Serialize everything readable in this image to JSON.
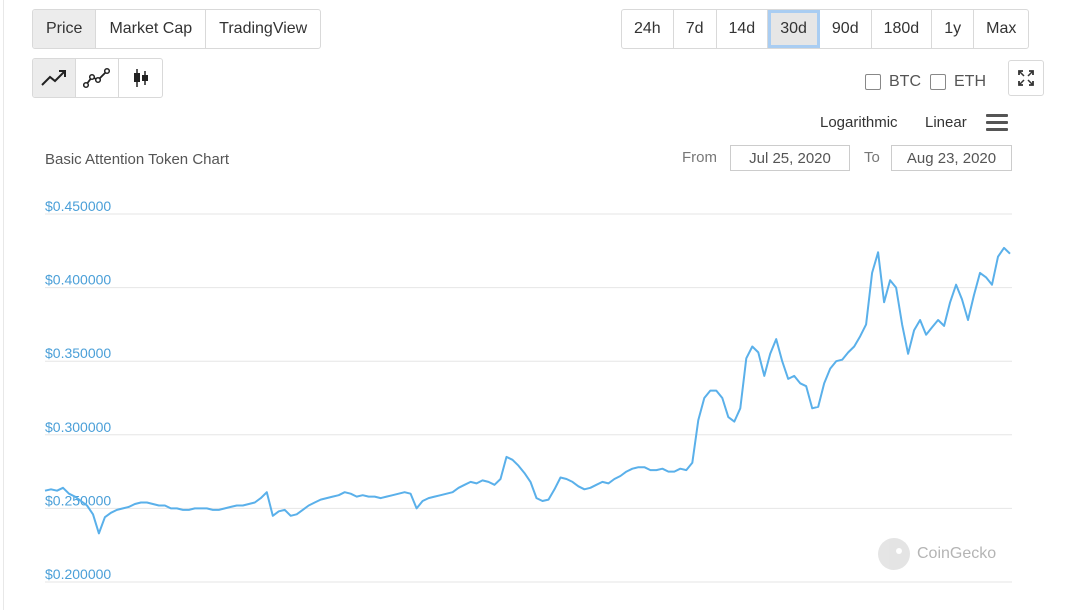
{
  "tabs": [
    {
      "label": "Price",
      "active": true
    },
    {
      "label": "Market Cap",
      "active": false
    },
    {
      "label": "TradingView",
      "active": false
    }
  ],
  "ranges": [
    {
      "label": "24h",
      "selected": false
    },
    {
      "label": "7d",
      "selected": false
    },
    {
      "label": "14d",
      "selected": false
    },
    {
      "label": "30d",
      "selected": true
    },
    {
      "label": "90d",
      "selected": false
    },
    {
      "label": "180d",
      "selected": false
    },
    {
      "label": "1y",
      "selected": false
    },
    {
      "label": "Max",
      "selected": false
    }
  ],
  "chart_types": [
    {
      "icon": "line-chart-icon",
      "active": true
    },
    {
      "icon": "points-line-chart-icon",
      "active": false
    },
    {
      "icon": "candlestick-icon",
      "active": false
    }
  ],
  "compare": {
    "btc_label": "BTC",
    "eth_label": "ETH"
  },
  "scale": {
    "log_label": "Logarithmic",
    "linear_label": "Linear"
  },
  "range_inputs": {
    "from_label": "From",
    "from_value": "Jul 25, 2020",
    "to_label": "To",
    "to_value": "Aug 23, 2020"
  },
  "watermark": "CoinGecko",
  "colors": {
    "line": "#5ab0ea",
    "axis_text": "#4a9fd8",
    "grid": "#e6e6e6",
    "selected_outline": "#a9cdf2"
  },
  "chart_data": {
    "type": "line",
    "title": "Basic Attention Token Chart",
    "x_range": [
      "Jul 25, 2020",
      "Aug 23, 2020"
    ],
    "ylim": [
      0.2,
      0.45
    ],
    "y_ticks": [
      "$0.450000",
      "$0.400000",
      "$0.350000",
      "$0.300000",
      "$0.250000",
      "$0.200000"
    ],
    "grid": true,
    "series": [
      {
        "values": [
          0.262,
          0.263,
          0.262,
          0.264,
          0.26,
          0.258,
          0.255,
          0.252,
          0.246,
          0.233,
          0.244,
          0.247,
          0.249,
          0.25,
          0.251,
          0.253,
          0.254,
          0.254,
          0.253,
          0.252,
          0.252,
          0.25,
          0.25,
          0.249,
          0.249,
          0.25,
          0.25,
          0.25,
          0.249,
          0.249,
          0.25,
          0.251,
          0.252,
          0.252,
          0.253,
          0.254,
          0.257,
          0.261,
          0.245,
          0.248,
          0.249,
          0.245,
          0.246,
          0.249,
          0.252,
          0.254,
          0.256,
          0.257,
          0.258,
          0.259,
          0.261,
          0.26,
          0.258,
          0.259,
          0.258,
          0.258,
          0.257,
          0.258,
          0.259,
          0.26,
          0.261,
          0.26,
          0.25,
          0.255,
          0.257,
          0.258,
          0.259,
          0.26,
          0.261,
          0.264,
          0.266,
          0.268,
          0.267,
          0.269,
          0.268,
          0.266,
          0.27,
          0.285,
          0.283,
          0.279,
          0.274,
          0.268,
          0.257,
          0.255,
          0.256,
          0.263,
          0.271,
          0.27,
          0.268,
          0.265,
          0.263,
          0.264,
          0.266,
          0.268,
          0.267,
          0.27,
          0.272,
          0.275,
          0.277,
          0.278,
          0.278,
          0.276,
          0.276,
          0.277,
          0.275,
          0.275,
          0.277,
          0.276,
          0.281,
          0.31,
          0.325,
          0.33,
          0.33,
          0.325,
          0.312,
          0.309,
          0.318,
          0.352,
          0.36,
          0.356,
          0.34,
          0.355,
          0.365,
          0.35,
          0.338,
          0.34,
          0.335,
          0.333,
          0.318,
          0.319,
          0.335,
          0.345,
          0.35,
          0.351,
          0.356,
          0.36,
          0.367,
          0.375,
          0.41,
          0.424,
          0.39,
          0.405,
          0.4,
          0.375,
          0.355,
          0.371,
          0.378,
          0.368,
          0.373,
          0.378,
          0.374,
          0.39,
          0.402,
          0.392,
          0.378,
          0.395,
          0.41,
          0.407,
          0.402,
          0.421,
          0.427,
          0.423
        ]
      }
    ]
  }
}
